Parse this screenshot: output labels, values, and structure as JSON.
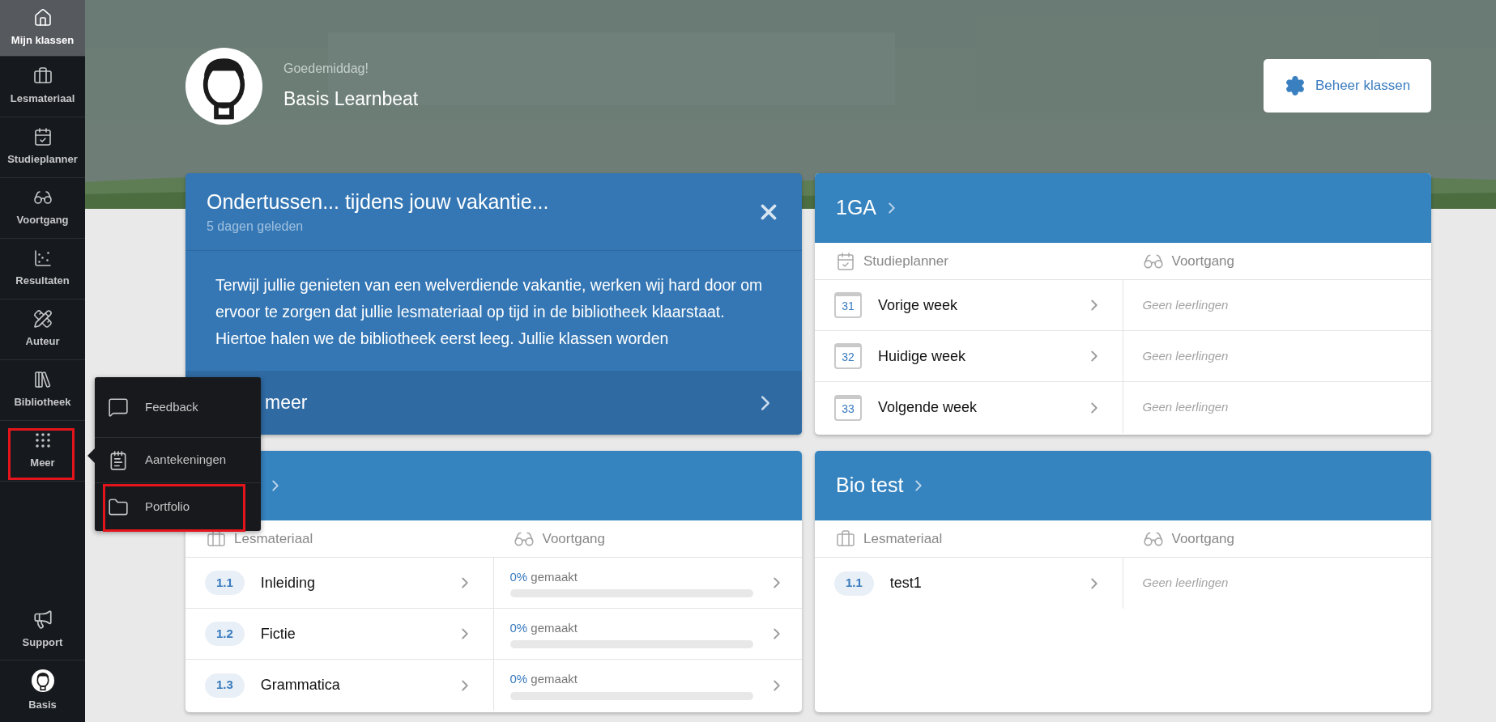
{
  "sidebar": {
    "items": [
      {
        "label": "Mijn klassen",
        "selected": true,
        "highlighted": false
      },
      {
        "label": "Lesmateriaal",
        "selected": false,
        "highlighted": false
      },
      {
        "label": "Studieplanner",
        "selected": false,
        "highlighted": false
      },
      {
        "label": "Voortgang",
        "selected": false,
        "highlighted": false
      },
      {
        "label": "Resultaten",
        "selected": false,
        "highlighted": false
      },
      {
        "label": "Auteur",
        "selected": false,
        "highlighted": false
      },
      {
        "label": "Bibliotheek",
        "selected": false,
        "highlighted": false
      },
      {
        "label": "Meer",
        "selected": false,
        "highlighted": true
      }
    ],
    "bottom_items": [
      {
        "label": "Support"
      },
      {
        "label": "Basis"
      }
    ]
  },
  "header": {
    "greeting": "Goedemiddag!",
    "name": "Basis Learnbeat",
    "manage_button": "Beheer klassen"
  },
  "popup_menu": {
    "items": [
      {
        "label": "Feedback",
        "highlighted": false
      },
      {
        "label": "Aantekeningen",
        "highlighted": false
      },
      {
        "label": "Portfolio",
        "highlighted": true
      }
    ]
  },
  "cards": [
    {
      "kind": "notice",
      "title": "Ondertussen... tijdens jouw vakantie...",
      "subtitle": "5 dagen geleden",
      "body": "Terwijl jullie genieten van een welverdiende vakantie, werken wij hard door om ervoor te zorgen dat jullie lesmateriaal op tijd in de bibliotheek klaarstaat. Hiertoe halen we de bibliotheek eerst leeg. Jullie klassen worden",
      "footer_link": "meer"
    },
    {
      "kind": "planner",
      "title": "1GA",
      "left_column": "Studieplanner",
      "right_column": "Voortgang",
      "rows": [
        {
          "kind": "week",
          "badge": "31",
          "label": "Vorige week",
          "note": "Geen leerlingen"
        },
        {
          "kind": "week",
          "badge": "32",
          "label": "Huidige week",
          "note": "Geen leerlingen"
        },
        {
          "kind": "week",
          "badge": "33",
          "label": "Volgende week",
          "note": "Geen leerlingen"
        }
      ]
    },
    {
      "kind": "material",
      "left_column": "Lesmateriaal",
      "right_column": "Voortgang",
      "rows": [
        {
          "kind": "progress",
          "badge": "1.1",
          "label": "Inleiding",
          "percent": "0%",
          "status": "gemaakt",
          "level": 0
        },
        {
          "kind": "progress",
          "badge": "1.2",
          "label": "Fictie",
          "percent": "0%",
          "status": "gemaakt",
          "level": 0
        },
        {
          "kind": "progress",
          "badge": "1.3",
          "label": "Grammatica",
          "percent": "0%",
          "status": "gemaakt",
          "level": 0
        }
      ]
    },
    {
      "kind": "material",
      "title": "Bio test",
      "left_column": "Lesmateriaal",
      "right_column": "Voortgang",
      "rows": [
        {
          "kind": "lesson",
          "badge": "1.1",
          "label": "test1",
          "note": "Geen leerlingen"
        }
      ]
    }
  ]
}
